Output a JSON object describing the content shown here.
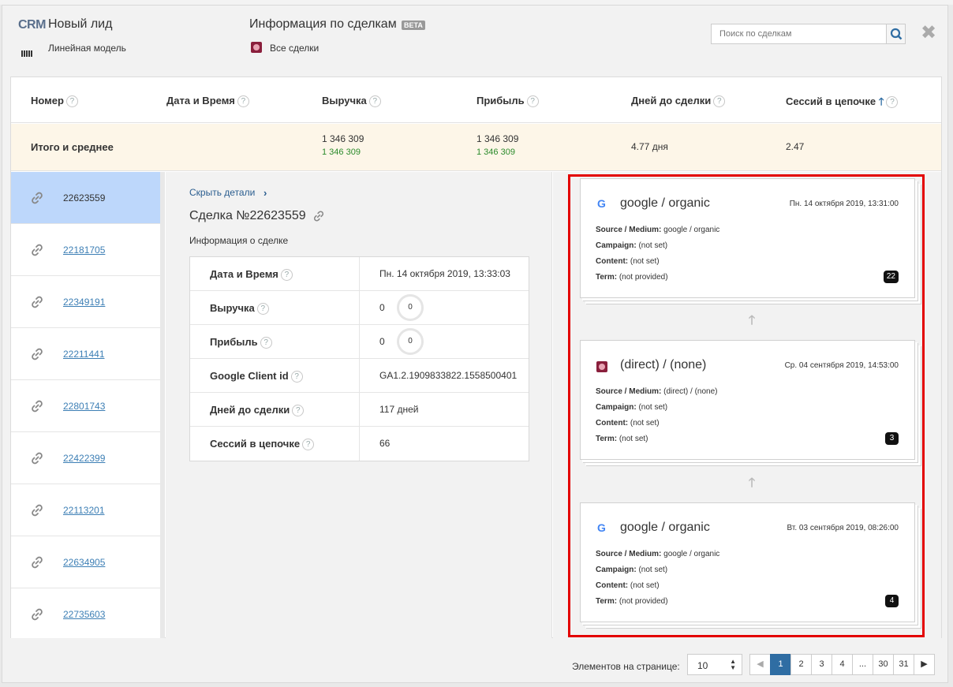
{
  "header": {
    "logo": "CRM",
    "title": "Новый лид",
    "model": "Линейная модель",
    "section_title": "Информация по сделкам",
    "beta_badge": "BETA",
    "filter": "Все сделки",
    "search_placeholder": "Поиск по сделкам"
  },
  "table": {
    "columns": [
      "Номер",
      "Дата и Время",
      "Выручка",
      "Прибыль",
      "Дней до сделки",
      "Сессий в цепочке"
    ],
    "totals": {
      "label": "Итого и среднее",
      "revenue": "1 346 309",
      "revenue_sub": "1 346 309",
      "profit": "1 346 309",
      "profit_sub": "1 346 309",
      "days": "4.77 дня",
      "sessions": "2.47"
    },
    "deals": [
      "22623559",
      "22181705",
      "22349191",
      "22211441",
      "22801743",
      "22422399",
      "22113201",
      "22634905",
      "22735603"
    ]
  },
  "details": {
    "hide_label": "Скрыть детали",
    "title": "Сделка №22623559",
    "subtitle": "Информация о сделке",
    "rows": [
      {
        "key": "Дата и Время",
        "value": "Пн. 14 октября 2019, 13:33:03"
      },
      {
        "key": "Выручка",
        "value": "0",
        "circle": "0"
      },
      {
        "key": "Прибыль",
        "value": "0",
        "circle": "0"
      },
      {
        "key": "Google Client id",
        "value": "GA1.2.1909833822.1558500401"
      },
      {
        "key": "Дней до сделки",
        "value": "117 дней"
      },
      {
        "key": "Сессий в цепочке",
        "value": "66"
      }
    ]
  },
  "chain": {
    "labels": {
      "source_medium": "Source / Medium:",
      "campaign": "Campaign:",
      "content": "Content:",
      "term": "Term:"
    },
    "cards": [
      {
        "icon": "google-icon",
        "title": "google / organic",
        "date": "Пн. 14 октября 2019, 13:31:00",
        "source_medium": "google / organic",
        "campaign": "(not set)",
        "content": "(not set)",
        "term": "(not provided)",
        "count": "22"
      },
      {
        "icon": "direct-icon",
        "title": "(direct) / (none)",
        "date": "Ср. 04 сентября 2019, 14:53:00",
        "source_medium": "(direct) / (none)",
        "campaign": "(not set)",
        "content": "(not set)",
        "term": "(not set)",
        "count": "3"
      },
      {
        "icon": "google-icon",
        "title": "google / organic",
        "date": "Вт. 03 сентября 2019, 08:26:00",
        "source_medium": "google / organic",
        "campaign": "(not set)",
        "content": "(not set)",
        "term": "(not provided)",
        "count": "4"
      }
    ]
  },
  "footer": {
    "per_page_label": "Элементов на странице:",
    "per_page_value": "10",
    "pages": [
      "1",
      "2",
      "3",
      "4",
      "...",
      "30",
      "31"
    ],
    "current_page": "1"
  },
  "colors": {
    "accent": "#2f6da3",
    "highlight": "#e30000",
    "active_row": "#bdd7fb",
    "totals_bg": "#fdf6e8"
  }
}
